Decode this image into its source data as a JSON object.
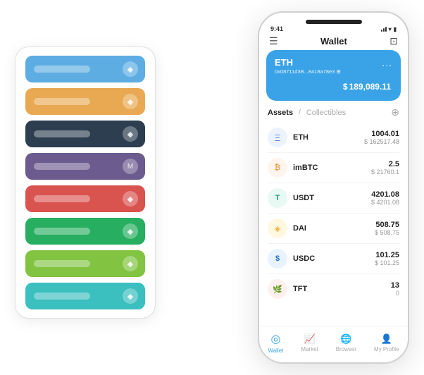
{
  "scene": {
    "card_stack": {
      "rows": [
        {
          "color": "row-blue",
          "label": "",
          "icon": "◆"
        },
        {
          "color": "row-orange",
          "label": "",
          "icon": "◆"
        },
        {
          "color": "row-dark",
          "label": "",
          "icon": "◆"
        },
        {
          "color": "row-purple",
          "label": "",
          "icon": "M"
        },
        {
          "color": "row-red",
          "label": "",
          "icon": "◆"
        },
        {
          "color": "row-green",
          "label": "",
          "icon": "◆"
        },
        {
          "color": "row-lime",
          "label": "",
          "icon": "◆"
        },
        {
          "color": "row-teal",
          "label": "",
          "icon": "◆"
        }
      ]
    },
    "phone": {
      "status_bar": {
        "time": "9:41",
        "battery": "▮"
      },
      "nav": {
        "title": "Wallet"
      },
      "eth_card": {
        "name": "ETH",
        "address": "0x08711d3B...8418a78e3 ⊞",
        "menu": "...",
        "currency": "$",
        "balance": "189,089.11"
      },
      "tabs": {
        "active": "Assets",
        "divider": "/",
        "inactive": "Collectibles"
      },
      "assets": [
        {
          "name": "ETH",
          "icon": "Ξ",
          "icon_class": "icon-eth",
          "amount": "1004.01",
          "usd": "$ 162517.48"
        },
        {
          "name": "imBTC",
          "icon": "₿",
          "icon_class": "icon-imbtc",
          "amount": "2.5",
          "usd": "$ 21760.1"
        },
        {
          "name": "USDT",
          "icon": "T",
          "icon_class": "icon-usdt",
          "amount": "4201.08",
          "usd": "$ 4201.08"
        },
        {
          "name": "DAI",
          "icon": "◈",
          "icon_class": "icon-dai",
          "amount": "508.75",
          "usd": "$ 508.75"
        },
        {
          "name": "USDC",
          "icon": "$",
          "icon_class": "icon-usdc",
          "amount": "101.25",
          "usd": "$ 101.25"
        },
        {
          "name": "TFT",
          "icon": "🌿",
          "icon_class": "icon-tft",
          "amount": "13",
          "usd": "0"
        }
      ],
      "bottom_nav": [
        {
          "label": "Wallet",
          "icon": "◎",
          "active": true
        },
        {
          "label": "Market",
          "icon": "📈",
          "active": false
        },
        {
          "label": "Browser",
          "icon": "🌐",
          "active": false
        },
        {
          "label": "My Profile",
          "icon": "👤",
          "active": false
        }
      ]
    }
  }
}
